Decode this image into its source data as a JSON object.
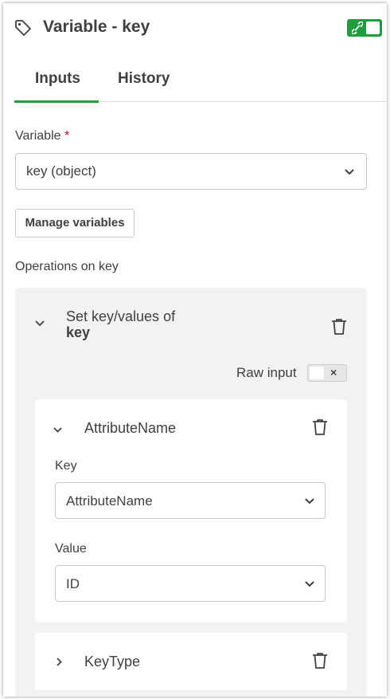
{
  "header": {
    "title": "Variable - key"
  },
  "tabs": [
    {
      "label": "Inputs"
    },
    {
      "label": "History"
    }
  ],
  "variable": {
    "label": "Variable",
    "required_mark": "*",
    "value": "key (object)"
  },
  "manage_button": "Manage variables",
  "operations": {
    "heading": "Operations on key",
    "op_title_line1": "Set key/values of",
    "op_title_line2": "key",
    "raw_input_label": "Raw input",
    "raw_toggle_glyph": "×",
    "items": [
      {
        "title": "AttributeName",
        "key_label": "Key",
        "key_value": "AttributeName",
        "value_label": "Value",
        "value_value": "ID"
      },
      {
        "title": "KeyType"
      }
    ]
  },
  "colors": {
    "accent": "#1f9e3e",
    "text": "#404040",
    "ops_bg": "#f2f2f2",
    "required": "#d0021b"
  }
}
